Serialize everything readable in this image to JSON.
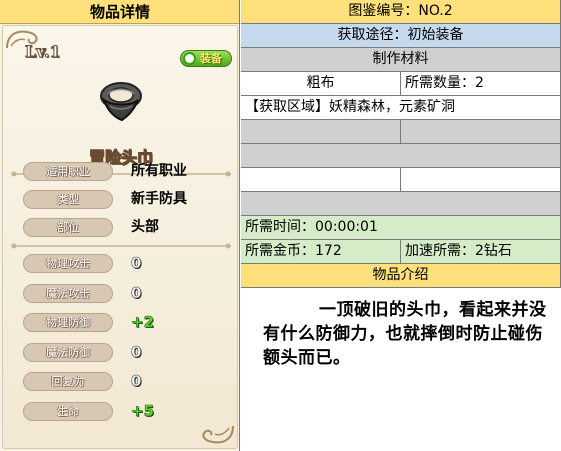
{
  "left": {
    "header": "物品详情",
    "level": "Lv.1",
    "equip_button": "装备",
    "item_name": "冒险头巾",
    "info": [
      {
        "label": "适用职业",
        "value": "所有职业"
      },
      {
        "label": "类型",
        "value": "新手防具"
      },
      {
        "label": "部位",
        "value": "头部"
      }
    ],
    "stats": [
      {
        "label": "物理攻击",
        "value": "0"
      },
      {
        "label": "魔法攻击",
        "value": "0"
      },
      {
        "label": "物理防御",
        "value": "+2"
      },
      {
        "label": "魔法防御",
        "value": "0"
      },
      {
        "label": "回复力",
        "value": "0"
      },
      {
        "label": "生命",
        "value": "+5"
      }
    ]
  },
  "right": {
    "codex_no": "图鉴编号：NO.2",
    "acquire": "获取途径：初始装备",
    "materials_header": "制作材料",
    "material_name": "粗布",
    "material_qty": "所需数量：2",
    "region": "【获取区域】妖精森林，元素矿洞",
    "time": "所需时间：00:00:01",
    "gold": "所需金币：172",
    "speedup": "加速所需：2钻石",
    "intro_header": "物品介绍",
    "description": "一顶破旧的头巾，看起来并没有什么防御力，也就摔倒时防止碰伤额头而已。"
  },
  "colors": {
    "header_yellow": "#ffe07a",
    "row_blue": "#c5d9ef",
    "row_gray": "#d0d0d0",
    "row_green": "#d4ecc8",
    "stat_positive": "#5ee02a"
  },
  "icons": {
    "item": "bandana-icon",
    "equip": "equip-badge-icon"
  }
}
